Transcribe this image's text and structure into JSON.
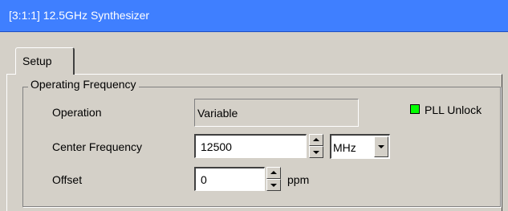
{
  "window": {
    "title": "[3:1:1] 12.5GHz Synthesizer"
  },
  "tabs": [
    {
      "label": "Setup",
      "active": true
    }
  ],
  "group": {
    "title": "Operating Frequency"
  },
  "fields": {
    "operation": {
      "label": "Operation",
      "value": "Variable"
    },
    "center_frequency": {
      "label": "Center Frequency",
      "value": "12500",
      "unit": "MHz"
    },
    "offset": {
      "label": "Offset",
      "value": "0",
      "unit": "ppm"
    }
  },
  "status": {
    "pll_unlock": {
      "label": "PLL Unlock",
      "indicator_color": "#00ff00"
    }
  },
  "colors": {
    "titlebar": "#3f7fff",
    "background": "#d4d0c8"
  }
}
